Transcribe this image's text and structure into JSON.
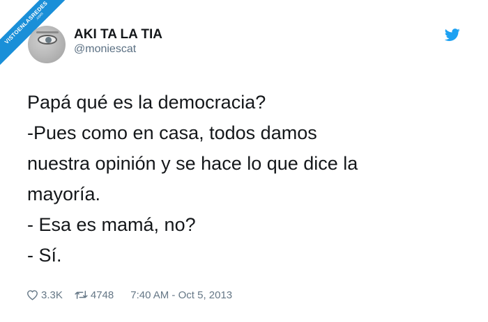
{
  "watermark": {
    "line1": "VISTOENLASREDES",
    "line2": ".com",
    "color": "#1a8fd8"
  },
  "user": {
    "display_name": "AKI TA LA TIA",
    "handle": "@moniescat",
    "avatar_icon": "eye-avatar-icon"
  },
  "brand_icon": "twitter-bird-icon",
  "brand_color": "#1da1f2",
  "tweet": {
    "lines": [
      "Papá qué es la democracia?",
      "-Pues como en casa, todos damos",
      "nuestra opinión y se hace lo que dice la",
      "mayoría.",
      "- Esa es mamá, no?",
      "- Sí."
    ]
  },
  "stats": {
    "likes": "3.3K",
    "retweets": "4748",
    "timestamp": "7:40 AM - Oct 5, 2013",
    "like_icon": "heart-icon",
    "retweet_icon": "retweet-icon"
  }
}
